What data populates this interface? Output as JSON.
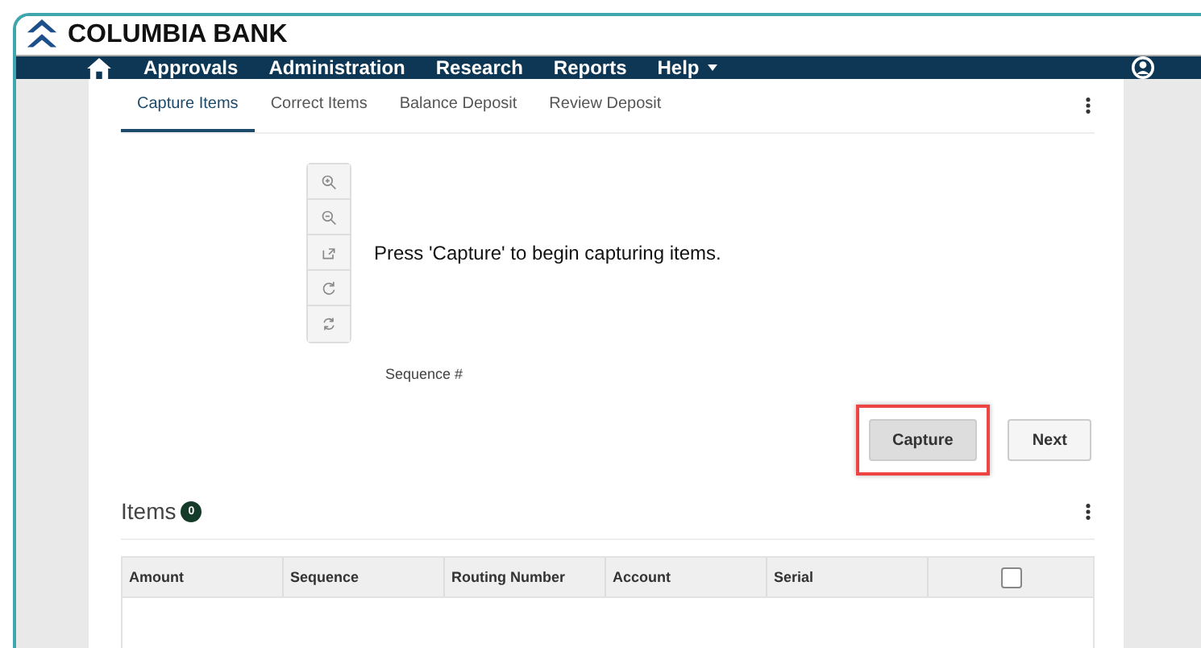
{
  "brand": {
    "name": "COLUMBIA BANK"
  },
  "nav": {
    "items": [
      {
        "label": "Approvals",
        "dropdown": false
      },
      {
        "label": "Administration",
        "dropdown": false
      },
      {
        "label": "Research",
        "dropdown": false
      },
      {
        "label": "Reports",
        "dropdown": false
      },
      {
        "label": "Help",
        "dropdown": true
      }
    ]
  },
  "tabs": [
    {
      "label": "Capture Items",
      "selected": true
    },
    {
      "label": "Correct Items",
      "selected": false
    },
    {
      "label": "Balance Deposit",
      "selected": false
    },
    {
      "label": "Review Deposit",
      "selected": false
    }
  ],
  "message": "Press 'Capture' to begin capturing items.",
  "sequence_label": "Sequence #",
  "buttons": [
    {
      "label": "Capture",
      "highlighted": true
    },
    {
      "label": "Next",
      "highlighted": false
    }
  ],
  "items": {
    "title": "Items",
    "count": "0",
    "columns": [
      "Amount",
      "Sequence",
      "Routing Number",
      "Account",
      "Serial"
    ],
    "select_all_checked": false
  }
}
